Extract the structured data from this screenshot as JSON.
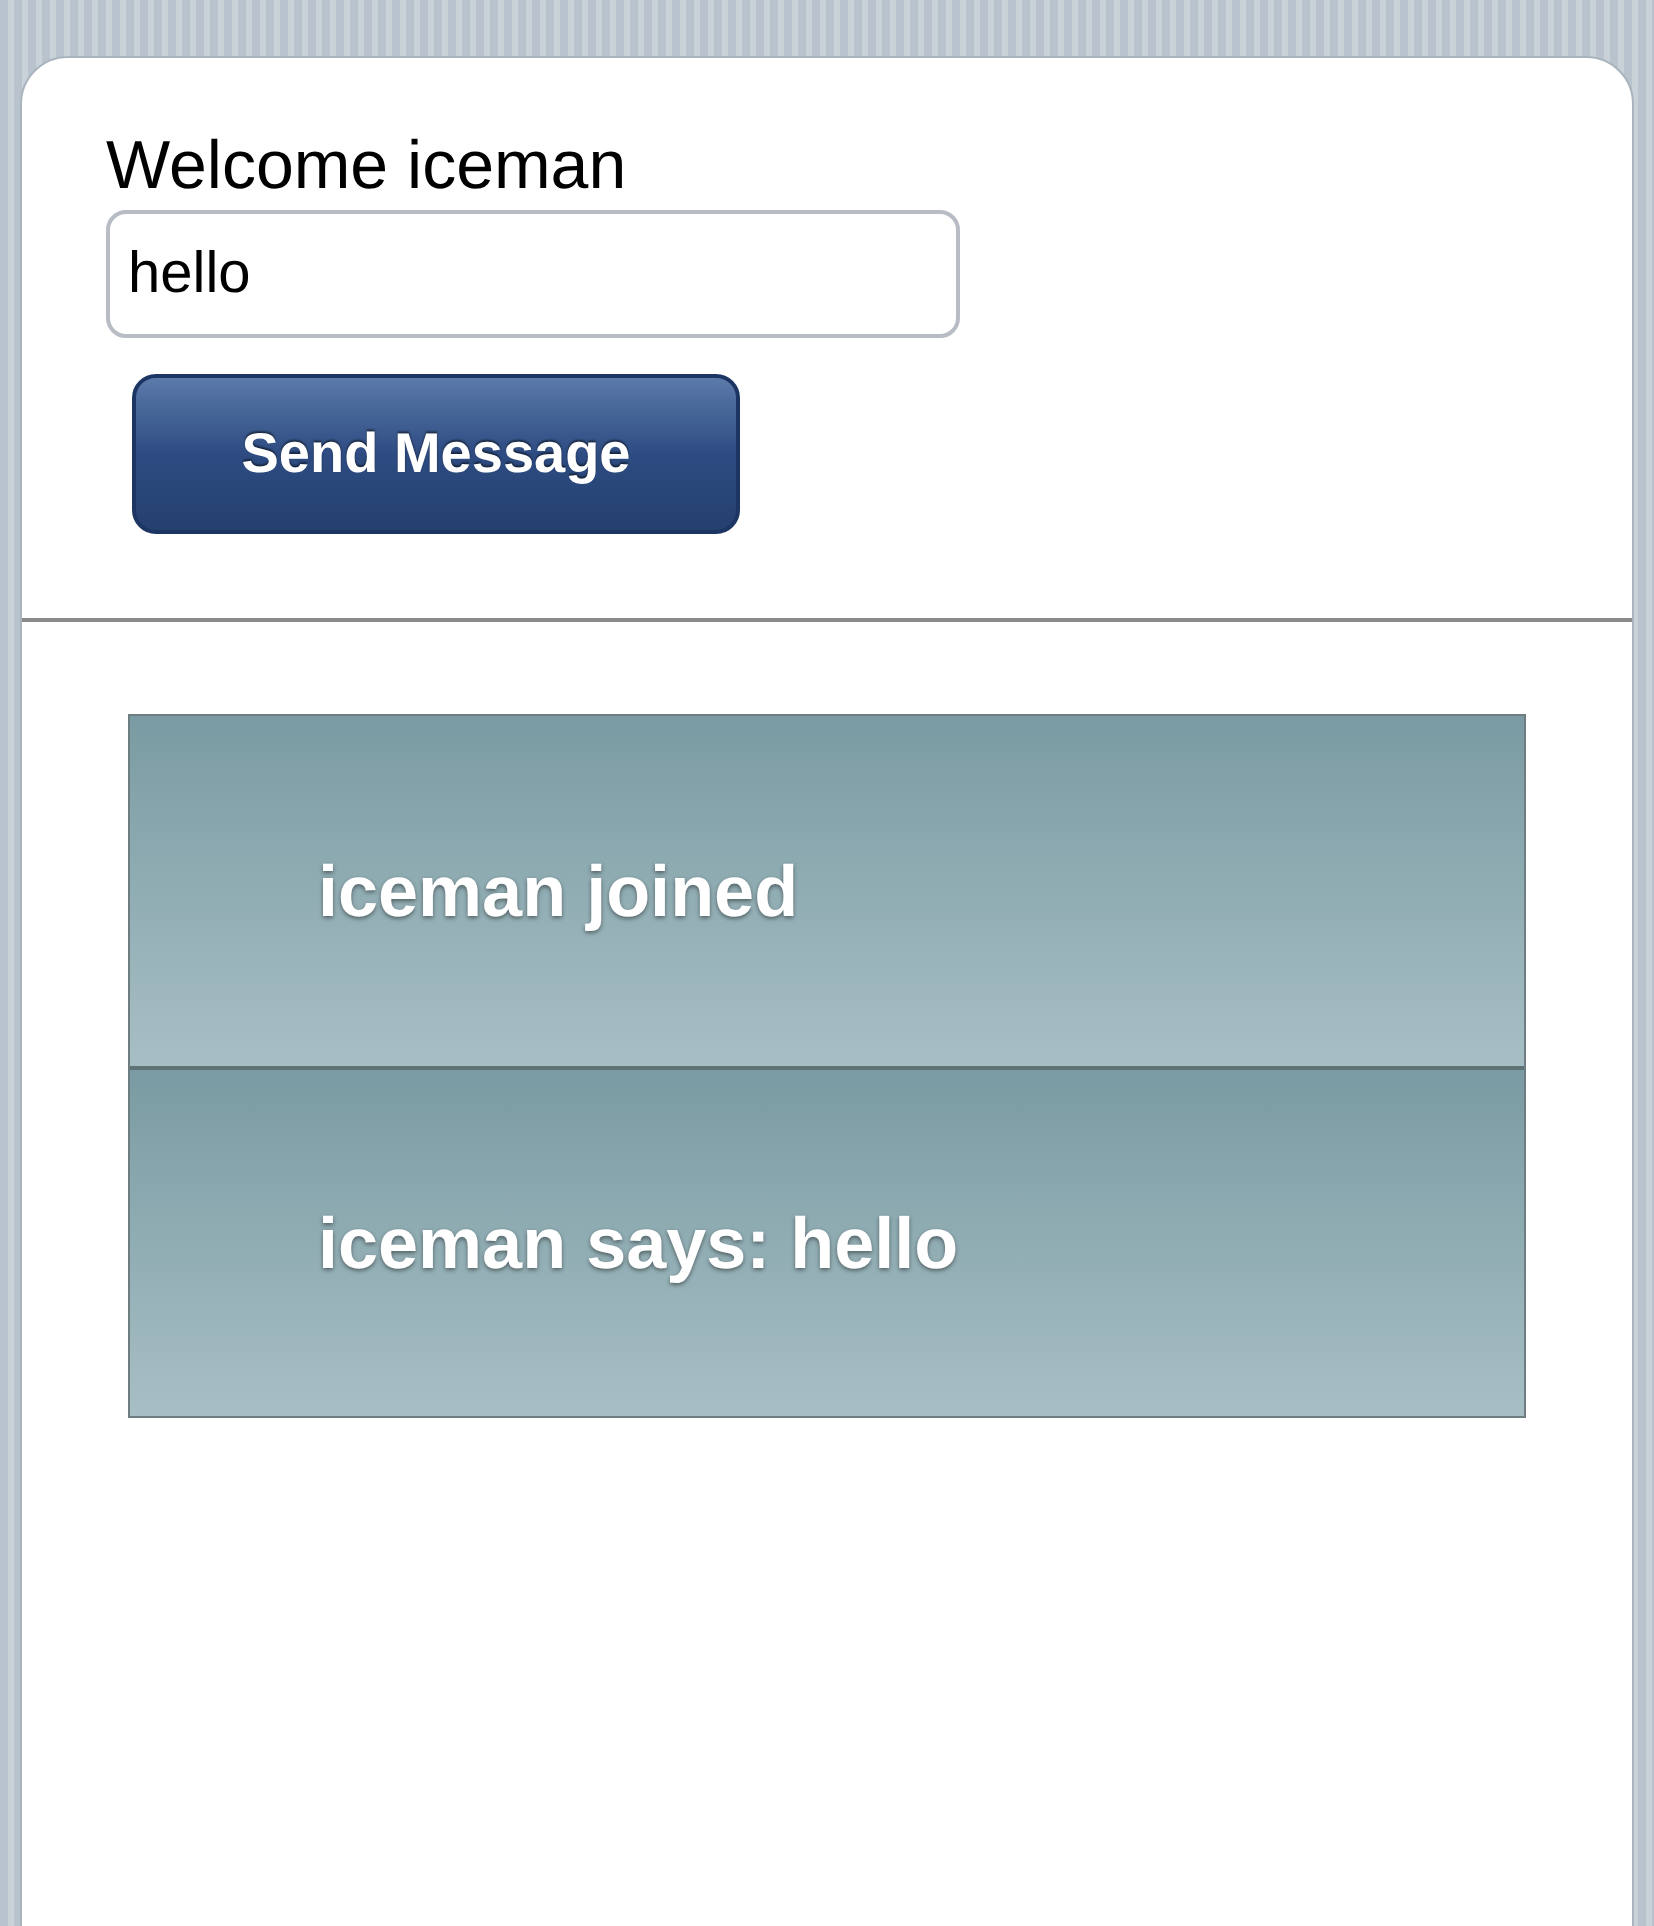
{
  "header": {
    "welcome": "Welcome iceman"
  },
  "message_field": {
    "value": "hello"
  },
  "send_button": {
    "label": "Send Message"
  },
  "messages": [
    {
      "text": "iceman joined"
    },
    {
      "text": "iceman says: hello"
    }
  ]
}
